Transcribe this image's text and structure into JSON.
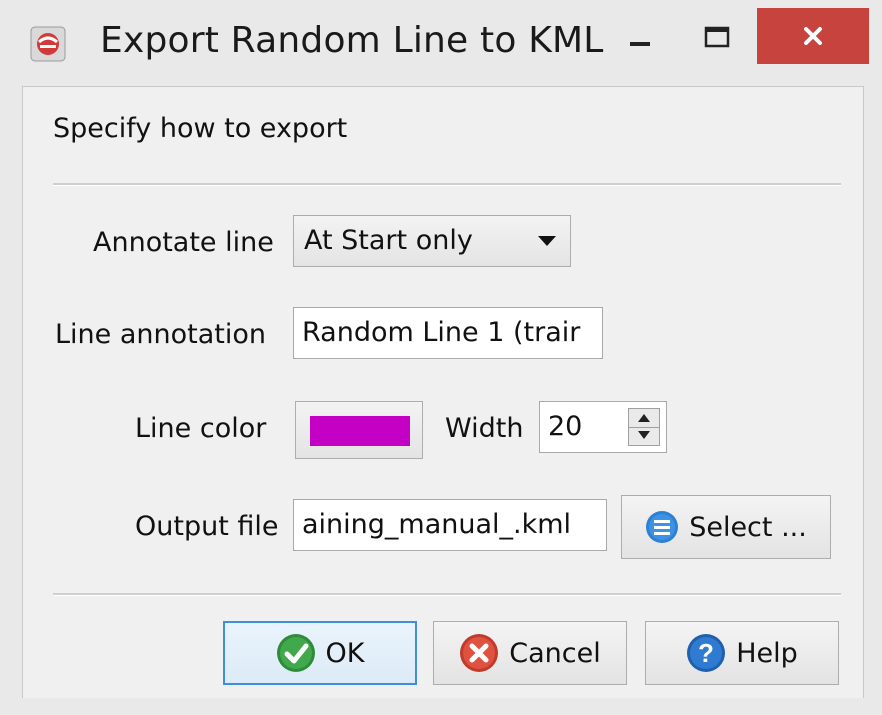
{
  "window": {
    "title": "Export Random Line to KML",
    "icons": {
      "app": "app-logo-icon",
      "minimize": "minimize-icon",
      "maximize": "maximize-icon",
      "close": "close-icon"
    },
    "close_color": "#c7443e"
  },
  "dialog": {
    "heading": "Specify how to export",
    "annotate_line": {
      "label": "Annotate line",
      "selected": "At Start only"
    },
    "line_annotation": {
      "label": "Line annotation",
      "value": "Random Line 1 (trair"
    },
    "line_color": {
      "label": "Line color",
      "color": "#c400c4"
    },
    "width": {
      "label": "Width",
      "value": "20"
    },
    "output_file": {
      "label": "Output file",
      "value": "aining_manual_.kml"
    },
    "select_button": {
      "label": "Select ...",
      "icon": "list-icon"
    }
  },
  "buttons": {
    "ok": {
      "label": "OK",
      "icon": "checkmark-icon"
    },
    "cancel": {
      "label": "Cancel",
      "icon": "cancel-x-icon"
    },
    "help": {
      "label": "Help",
      "icon": "help-question-icon"
    }
  }
}
